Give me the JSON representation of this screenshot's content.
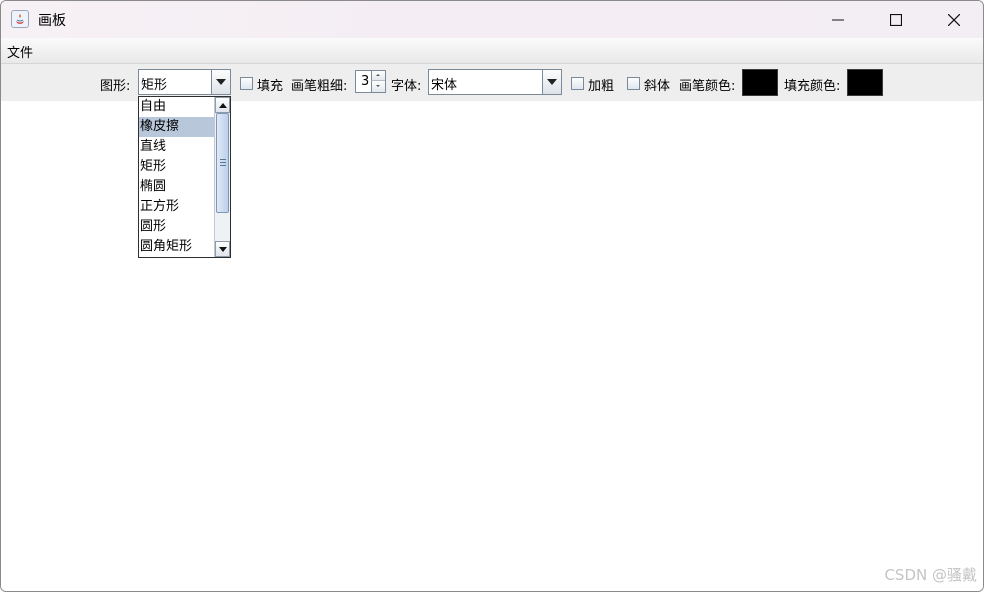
{
  "window": {
    "title": "画板",
    "colors": {
      "title_bg": "#f4eff4",
      "menu_bg": "#f0f0f0",
      "toolbar_bg": "#eeeeee"
    }
  },
  "menubar": {
    "items": [
      {
        "label": "文件"
      }
    ]
  },
  "toolbar": {
    "shape_label": "图形:",
    "shape_selected": "矩形",
    "fill_checkbox_label": "填充",
    "fill_checked": false,
    "stroke_label": "画笔粗细:",
    "stroke_value": "3",
    "font_label": "字体:",
    "font_selected": "宋体",
    "bold_label": "加粗",
    "bold_checked": false,
    "italic_label": "斜体",
    "italic_checked": false,
    "pen_color_label": "画笔颜色:",
    "pen_color": "#000000",
    "fill_color_label": "填充颜色:",
    "fill_color": "#000000"
  },
  "shape_dropdown": {
    "open": true,
    "highlighted_index": 1,
    "options": [
      "自由",
      "橡皮擦",
      "直线",
      "矩形",
      "椭圆",
      "正方形",
      "圆形",
      "圆角矩形"
    ]
  },
  "watermark": "CSDN @骚戴"
}
